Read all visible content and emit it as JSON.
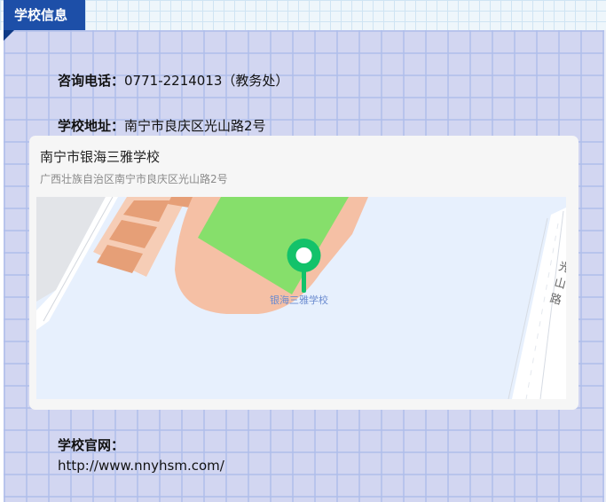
{
  "section": {
    "title": "学校信息"
  },
  "contact": {
    "phone_label": "咨询电话：",
    "phone_value": "0771-2214013（教务处）",
    "address_label": "学校地址：",
    "address_value": "南宁市良庆区光山路2号",
    "website_label": "学校官网：",
    "website_value": "http://www.nnyhsm.com/"
  },
  "map": {
    "place_name": "南宁市银海三雅学校",
    "place_address": "广西壮族自治区南宁市良庆区光山路2号",
    "marker_label": "银海三雅学校",
    "road_label": "光山路",
    "marker_icon": "map-pin-icon",
    "colors": {
      "background": "#e7f0fd",
      "field": "#86df6b",
      "track": "#f5c0a5",
      "building": "#e69f77",
      "road": "#ffffff",
      "marker": "#13c26a"
    }
  }
}
